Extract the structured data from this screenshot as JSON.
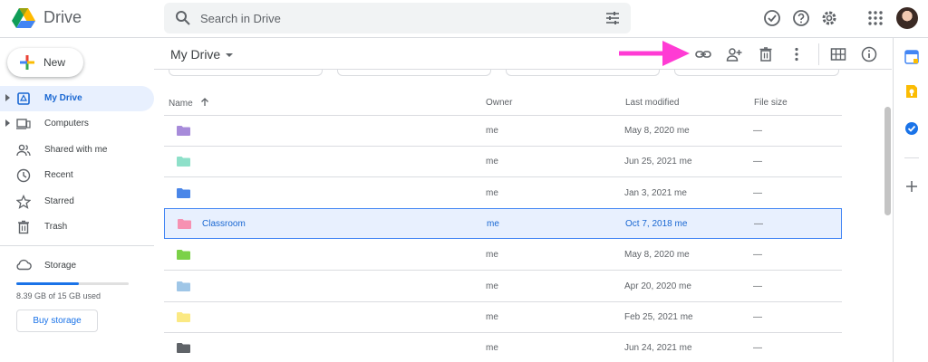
{
  "app": {
    "title": "Drive"
  },
  "search": {
    "placeholder": "Search in Drive"
  },
  "sidebar": {
    "new_label": "New",
    "items": [
      {
        "label": "My Drive"
      },
      {
        "label": "Computers"
      },
      {
        "label": "Shared with me"
      },
      {
        "label": "Recent"
      },
      {
        "label": "Starred"
      },
      {
        "label": "Trash"
      }
    ],
    "storage": {
      "title": "Storage",
      "used_text": "8.39 GB of 15 GB used",
      "used_fraction": 0.56,
      "buy_label": "Buy storage"
    }
  },
  "main": {
    "title": "My Drive",
    "columns": {
      "name": "Name",
      "owner": "Owner",
      "modified": "Last modified",
      "size": "File size"
    },
    "rows": [
      {
        "name": "",
        "owner": "me",
        "modified": "May 8, 2020",
        "modified_by": "me",
        "size": "—",
        "color": "#a78bda"
      },
      {
        "name": "",
        "owner": "me",
        "modified": "Jun 25, 2021",
        "modified_by": "me",
        "size": "—",
        "color": "#8ee0c9"
      },
      {
        "name": "",
        "owner": "me",
        "modified": "Jan 3, 2021",
        "modified_by": "me",
        "size": "—",
        "color": "#4a86e8"
      },
      {
        "name": "Classroom",
        "owner": "me",
        "modified": "Oct 7, 2018",
        "modified_by": "me",
        "size": "—",
        "color": "#f691b2",
        "selected": true
      },
      {
        "name": "",
        "owner": "me",
        "modified": "May 8, 2020",
        "modified_by": "me",
        "size": "—",
        "color": "#7bd148"
      },
      {
        "name": "",
        "owner": "me",
        "modified": "Apr 20, 2020",
        "modified_by": "me",
        "size": "—",
        "color": "#9fc6e7"
      },
      {
        "name": "",
        "owner": "me",
        "modified": "Feb 25, 2021",
        "modified_by": "me",
        "size": "—",
        "color": "#fbe983"
      },
      {
        "name": "",
        "owner": "me",
        "modified": "Jun 24, 2021",
        "modified_by": "me",
        "size": "—",
        "color": "#5f6368"
      }
    ]
  },
  "colors": {
    "accent": "#1a73e8",
    "selected_bg": "#e8f0fe",
    "arrow": "#ff3bd4"
  },
  "icons": {
    "toolbar": [
      "link-icon",
      "share-person-add-icon",
      "trash-icon",
      "more-vert-icon",
      "grid-view-icon",
      "info-icon"
    ],
    "top": [
      "offline-check-icon",
      "help-icon",
      "gear-icon",
      "apps-grid-icon"
    ],
    "right_panel": [
      "calendar-icon",
      "keep-icon",
      "tasks-icon",
      "add-icon"
    ]
  }
}
